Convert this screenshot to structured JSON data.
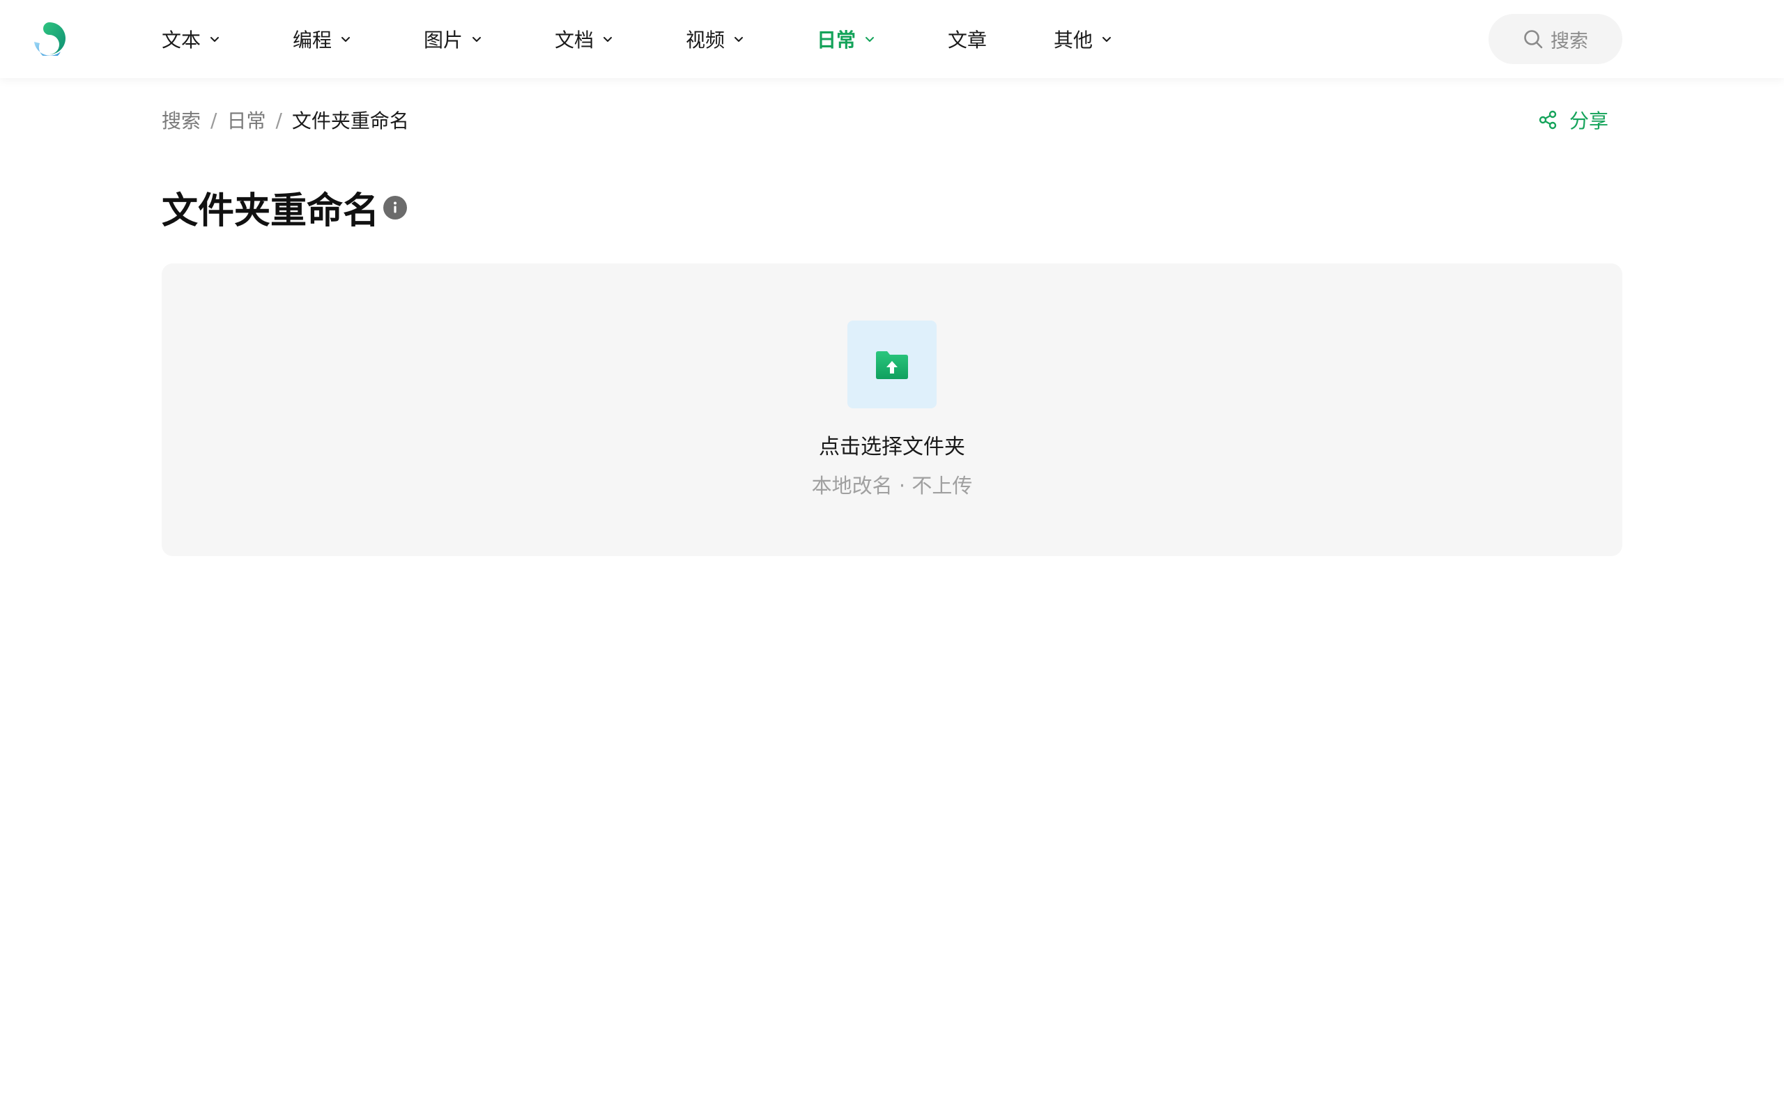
{
  "nav": {
    "items": [
      {
        "label": "文本",
        "has_dropdown": true,
        "active": false
      },
      {
        "label": "编程",
        "has_dropdown": true,
        "active": false
      },
      {
        "label": "图片",
        "has_dropdown": true,
        "active": false
      },
      {
        "label": "文档",
        "has_dropdown": true,
        "active": false
      },
      {
        "label": "视频",
        "has_dropdown": true,
        "active": false
      },
      {
        "label": "日常",
        "has_dropdown": true,
        "active": true
      },
      {
        "label": "文章",
        "has_dropdown": false,
        "active": false
      },
      {
        "label": "其他",
        "has_dropdown": true,
        "active": false
      }
    ],
    "search_label": "搜索"
  },
  "breadcrumb": {
    "items": [
      "搜索",
      "日常"
    ],
    "separator": "/",
    "current": "文件夹重命名"
  },
  "share_label": "分享",
  "page": {
    "title": "文件夹重命名"
  },
  "upload": {
    "label": "点击选择文件夹",
    "hint": "本地改名 · 不上传"
  },
  "colors": {
    "accent": "#14a35a",
    "panel_bg": "#f6f6f6",
    "folder_tile_bg": "#dff0fb"
  },
  "icons": {
    "logo": "app-logo",
    "search": "search-icon",
    "share": "share-icon",
    "info": "info-icon",
    "folder": "folder-upload-icon",
    "dropdown": "chevron-down-icon"
  }
}
